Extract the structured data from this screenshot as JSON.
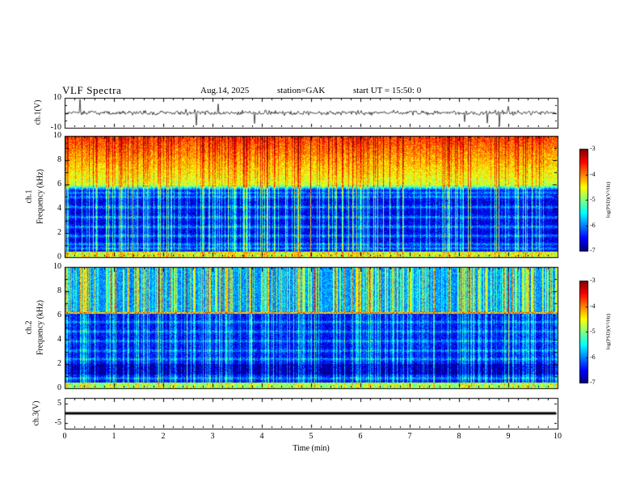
{
  "header": {
    "title": "VLF Spectra",
    "date": "Aug.14, 2025",
    "station": "station=GAK",
    "start_ut": "start UT =  15:50: 0"
  },
  "xaxis": {
    "label": "Time (min)",
    "range": [
      0,
      10
    ],
    "ticks": [
      "0",
      "1",
      "2",
      "3",
      "4",
      "5",
      "6",
      "7",
      "8",
      "9",
      "10"
    ]
  },
  "colors": {
    "background": "#ffffff",
    "axis": "#000000",
    "trace": "#000000"
  },
  "chart_data": [
    {
      "type": "line",
      "panel": "ch1_waveform",
      "ylabel": "ch.1(V)",
      "ylim": [
        -10,
        10
      ],
      "yticks": [
        "10",
        "-10"
      ],
      "signal": {
        "kind": "broadband-noise",
        "mean_V": 0,
        "typical_amplitude_V": 1.5,
        "spike_probability": 0.02,
        "spike_max_V": 9.5,
        "seed": 99
      }
    },
    {
      "type": "heatmap",
      "panel": "ch1_spectrogram",
      "ylabel": "ch.1",
      "ylabel2": "Frequency (kHz)",
      "ylim": [
        0,
        10
      ],
      "yticks": [
        "10",
        "8",
        "6",
        "4",
        "2",
        "0"
      ],
      "colorbar": {
        "label": "log(PSD)(V²/Hz)",
        "range": [
          -7,
          -3
        ],
        "ticks": [
          "-3",
          "-4",
          "-5",
          "-6",
          "-7"
        ],
        "colormap": "jet"
      },
      "features": {
        "seed": 1234,
        "high_band": {
          "f_khz": [
            6,
            10
          ],
          "psd_at_6khz": -4.78,
          "psd_slope_per_khz": 0.24
        },
        "transition_khz": [
          5.5,
          6.0
        ],
        "low_region_psd": -6.7,
        "horizontal_bands_khz": [
          0.7,
          1.05,
          1.75,
          2.5,
          3.3,
          4.15,
          5.0,
          5.35
        ],
        "band_amplitude": 0.6,
        "bottom_strip": {
          "f_khz": [
            0,
            0.45
          ],
          "psd": -4.7
        },
        "streak_probability": 0.3,
        "streak_gain_low": 0.85,
        "streak_gain_high": 0.5,
        "pixel_noise": 0.7
      }
    },
    {
      "type": "heatmap",
      "panel": "ch2_spectrogram",
      "ylabel": "ch.2",
      "ylabel2": "Frequency (kHz)",
      "ylim": [
        0,
        10
      ],
      "yticks": [
        "10",
        "8",
        "6",
        "4",
        "2",
        "0"
      ],
      "colorbar": {
        "label": "log(PSD)(V²/Hz)",
        "range": [
          -7,
          -3
        ],
        "ticks": [
          "-3",
          "-4",
          "-5",
          "-6",
          "-7"
        ],
        "colormap": "jet"
      },
      "features": {
        "seed": 5678,
        "narrowband_line": {
          "f_khz": 6.25,
          "psd": -4.3,
          "halfwidth_khz": 0.09
        },
        "high_region_psd": -6.0,
        "low_region_psd": -6.6,
        "dark_band_khz": [
          1.1,
          2.0
        ],
        "dark_band_delta": -0.35,
        "horizontal_bands_khz": [
          0.8,
          2.4,
          3.1,
          3.9,
          4.7,
          5.5
        ],
        "band_amplitude": 0.5,
        "bottom_strip": {
          "f_khz": [
            0,
            0.45
          ],
          "psd": -5.0
        },
        "streak_probability": 0.45,
        "streak_gain_low": 0.6,
        "streak_gain_high": 1.05,
        "pixel_noise": 0.7
      }
    },
    {
      "type": "line",
      "panel": "ch3_waveform",
      "ylabel": "ch.3(V)",
      "ylim": [
        -8,
        8
      ],
      "yticks": [
        "5",
        "-5"
      ],
      "signal": {
        "kind": "flat",
        "value_V": 0,
        "thickness_px": 3
      }
    }
  ]
}
